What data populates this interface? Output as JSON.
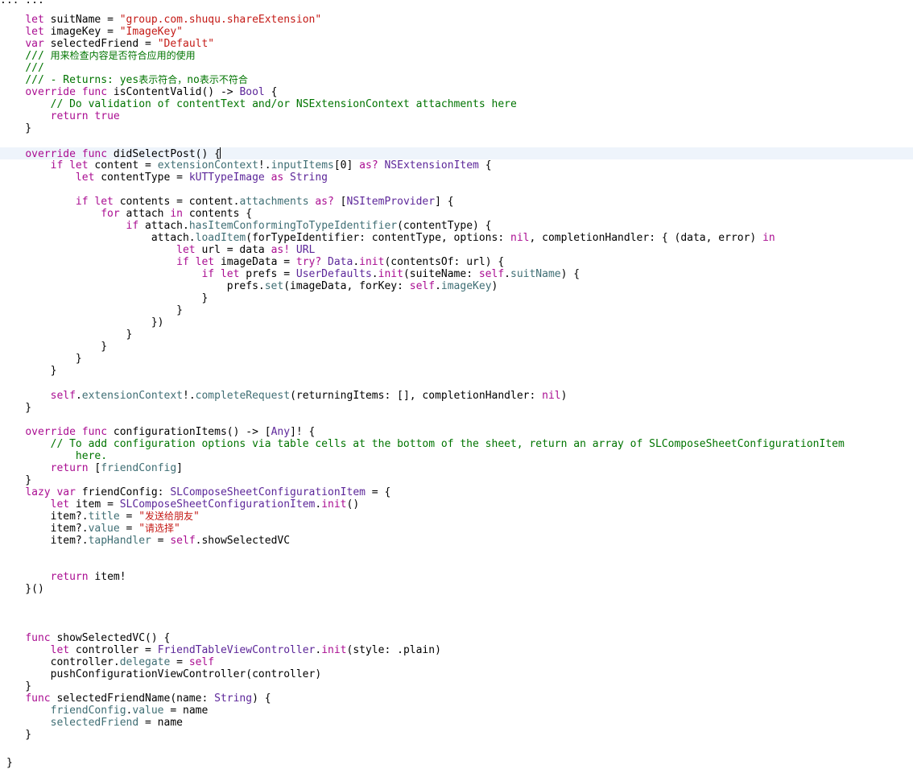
{
  "editor": {
    "language": "swift",
    "theme": {
      "keyword": "#aa0d91",
      "string": "#c41a16",
      "comment": "#007400",
      "type": "#5c2699",
      "member": "#3f6e74",
      "plain": "#000000",
      "current_line_bg": "#eef4fb"
    },
    "top_fragment": "            ...                                                                       ...",
    "cursor_line": 11,
    "trailing_brace": "}",
    "lines": [
      {
        "tokens": [
          {
            "t": "    "
          },
          {
            "t": "let",
            "c": "kw"
          },
          {
            "t": " suitName = "
          },
          {
            "t": "\"group.com.shuqu.shareExtension\"",
            "c": "str"
          }
        ]
      },
      {
        "tokens": [
          {
            "t": "    "
          },
          {
            "t": "let",
            "c": "kw"
          },
          {
            "t": " imageKey = "
          },
          {
            "t": "\"ImageKey\"",
            "c": "str"
          }
        ]
      },
      {
        "tokens": [
          {
            "t": "    "
          },
          {
            "t": "var",
            "c": "kw"
          },
          {
            "t": " selectedFriend = "
          },
          {
            "t": "\"Default\"",
            "c": "str"
          }
        ]
      },
      {
        "tokens": [
          {
            "t": "    "
          },
          {
            "t": "/// ",
            "c": "cmt"
          },
          {
            "t": "用来检查内容是否符合应用的使用",
            "c": "cmt",
            "f": "cjk"
          }
        ]
      },
      {
        "tokens": [
          {
            "t": "    "
          },
          {
            "t": "///",
            "c": "cmt"
          }
        ]
      },
      {
        "tokens": [
          {
            "t": "    "
          },
          {
            "t": "/// - Returns: yes",
            "c": "cmt"
          },
          {
            "t": "表示符合，",
            "c": "cmt",
            "f": "cjk"
          },
          {
            "t": "no",
            "c": "cmt"
          },
          {
            "t": "表示不符合",
            "c": "cmt",
            "f": "cjk"
          }
        ]
      },
      {
        "tokens": [
          {
            "t": "    "
          },
          {
            "t": "override",
            "c": "kw"
          },
          {
            "t": " "
          },
          {
            "t": "func",
            "c": "kw"
          },
          {
            "t": " isContentValid() -> "
          },
          {
            "t": "Bool",
            "c": "typ"
          },
          {
            "t": " {"
          }
        ]
      },
      {
        "tokens": [
          {
            "t": "        "
          },
          {
            "t": "// Do validation of contentText and/or NSExtensionContext attachments here",
            "c": "cmt"
          }
        ]
      },
      {
        "tokens": [
          {
            "t": "        "
          },
          {
            "t": "return",
            "c": "kw"
          },
          {
            "t": " "
          },
          {
            "t": "true",
            "c": "kw"
          }
        ]
      },
      {
        "tokens": [
          {
            "t": "    }"
          }
        ]
      },
      {
        "tokens": []
      },
      {
        "tokens": [
          {
            "t": "    "
          },
          {
            "t": "override",
            "c": "kw"
          },
          {
            "t": " "
          },
          {
            "t": "func",
            "c": "kw"
          },
          {
            "t": " didSelectPost() {"
          }
        ]
      },
      {
        "tokens": [
          {
            "t": "        "
          },
          {
            "t": "if",
            "c": "kw"
          },
          {
            "t": " "
          },
          {
            "t": "let",
            "c": "kw"
          },
          {
            "t": " content = "
          },
          {
            "t": "extensionContext",
            "c": "prop"
          },
          {
            "t": "!."
          },
          {
            "t": "inputItems",
            "c": "prop"
          },
          {
            "t": "[0] "
          },
          {
            "t": "as?",
            "c": "kw"
          },
          {
            "t": " "
          },
          {
            "t": "NSExtensionItem",
            "c": "typ"
          },
          {
            "t": " {"
          }
        ]
      },
      {
        "tokens": [
          {
            "t": "            "
          },
          {
            "t": "let",
            "c": "kw"
          },
          {
            "t": " contentType = "
          },
          {
            "t": "kUTTypeImage",
            "c": "typ"
          },
          {
            "t": " "
          },
          {
            "t": "as",
            "c": "kw"
          },
          {
            "t": " "
          },
          {
            "t": "String",
            "c": "typ"
          }
        ]
      },
      {
        "tokens": []
      },
      {
        "tokens": [
          {
            "t": "            "
          },
          {
            "t": "if",
            "c": "kw"
          },
          {
            "t": " "
          },
          {
            "t": "let",
            "c": "kw"
          },
          {
            "t": " contents = content."
          },
          {
            "t": "attachments",
            "c": "prop"
          },
          {
            "t": " "
          },
          {
            "t": "as?",
            "c": "kw"
          },
          {
            "t": " ["
          },
          {
            "t": "NSItemProvider",
            "c": "typ"
          },
          {
            "t": "] {"
          }
        ]
      },
      {
        "tokens": [
          {
            "t": "                "
          },
          {
            "t": "for",
            "c": "kw"
          },
          {
            "t": " attach "
          },
          {
            "t": "in",
            "c": "kw"
          },
          {
            "t": " contents {"
          }
        ]
      },
      {
        "tokens": [
          {
            "t": "                    "
          },
          {
            "t": "if",
            "c": "kw"
          },
          {
            "t": " attach."
          },
          {
            "t": "hasItemConformingToTypeIdentifier",
            "c": "prop"
          },
          {
            "t": "(contentType) {"
          }
        ]
      },
      {
        "tokens": [
          {
            "t": "                        attach."
          },
          {
            "t": "loadItem",
            "c": "prop"
          },
          {
            "t": "(forTypeIdentifier: contentType, options: "
          },
          {
            "t": "nil",
            "c": "kw"
          },
          {
            "t": ", completionHandler: { (data, error) "
          },
          {
            "t": "in",
            "c": "kw"
          }
        ]
      },
      {
        "tokens": [
          {
            "t": "                            "
          },
          {
            "t": "let",
            "c": "kw"
          },
          {
            "t": " url = data "
          },
          {
            "t": "as!",
            "c": "kw"
          },
          {
            "t": " "
          },
          {
            "t": "URL",
            "c": "typ"
          }
        ]
      },
      {
        "tokens": [
          {
            "t": "                            "
          },
          {
            "t": "if",
            "c": "kw"
          },
          {
            "t": " "
          },
          {
            "t": "let",
            "c": "kw"
          },
          {
            "t": " imageData = "
          },
          {
            "t": "try?",
            "c": "kw"
          },
          {
            "t": " "
          },
          {
            "t": "Data",
            "c": "typ"
          },
          {
            "t": "."
          },
          {
            "t": "init",
            "c": "kw"
          },
          {
            "t": "(contentsOf: url) {"
          }
        ]
      },
      {
        "tokens": [
          {
            "t": "                                "
          },
          {
            "t": "if",
            "c": "kw"
          },
          {
            "t": " "
          },
          {
            "t": "let",
            "c": "kw"
          },
          {
            "t": " prefs = "
          },
          {
            "t": "UserDefaults",
            "c": "typ"
          },
          {
            "t": "."
          },
          {
            "t": "init",
            "c": "kw"
          },
          {
            "t": "(suiteName: "
          },
          {
            "t": "self",
            "c": "kw"
          },
          {
            "t": "."
          },
          {
            "t": "suitName",
            "c": "prop"
          },
          {
            "t": ") {"
          }
        ]
      },
      {
        "tokens": [
          {
            "t": "                                    prefs."
          },
          {
            "t": "set",
            "c": "prop"
          },
          {
            "t": "(imageData, forKey: "
          },
          {
            "t": "self",
            "c": "kw"
          },
          {
            "t": "."
          },
          {
            "t": "imageKey",
            "c": "prop"
          },
          {
            "t": ")"
          }
        ]
      },
      {
        "tokens": [
          {
            "t": "                                }"
          }
        ]
      },
      {
        "tokens": [
          {
            "t": "                            }"
          }
        ]
      },
      {
        "tokens": [
          {
            "t": "                        })"
          }
        ]
      },
      {
        "tokens": [
          {
            "t": "                    }"
          }
        ]
      },
      {
        "tokens": [
          {
            "t": "                }"
          }
        ]
      },
      {
        "tokens": [
          {
            "t": "            }"
          }
        ]
      },
      {
        "tokens": [
          {
            "t": "        }"
          }
        ]
      },
      {
        "tokens": []
      },
      {
        "tokens": [
          {
            "t": "        "
          },
          {
            "t": "self",
            "c": "kw"
          },
          {
            "t": "."
          },
          {
            "t": "extensionContext",
            "c": "prop"
          },
          {
            "t": "!."
          },
          {
            "t": "completeRequest",
            "c": "prop"
          },
          {
            "t": "(returningItems: [], completionHandler: "
          },
          {
            "t": "nil",
            "c": "kw"
          },
          {
            "t": ")"
          }
        ]
      },
      {
        "tokens": [
          {
            "t": "    }"
          }
        ]
      },
      {
        "tokens": []
      },
      {
        "tokens": [
          {
            "t": "    "
          },
          {
            "t": "override",
            "c": "kw"
          },
          {
            "t": " "
          },
          {
            "t": "func",
            "c": "kw"
          },
          {
            "t": " configurationItems() -> ["
          },
          {
            "t": "Any",
            "c": "typ"
          },
          {
            "t": "]! {"
          }
        ]
      },
      {
        "tokens": [
          {
            "t": "        "
          },
          {
            "t": "// To add configuration options via table cells at the bottom of the sheet, return an array of SLComposeSheetConfigurationItem",
            "c": "cmt"
          }
        ]
      },
      {
        "tokens": [
          {
            "t": "            "
          },
          {
            "t": "here.",
            "c": "cmt"
          }
        ]
      },
      {
        "tokens": [
          {
            "t": "        "
          },
          {
            "t": "return",
            "c": "kw"
          },
          {
            "t": " ["
          },
          {
            "t": "friendConfig",
            "c": "prop"
          },
          {
            "t": "]"
          }
        ]
      },
      {
        "tokens": [
          {
            "t": "    }"
          }
        ]
      },
      {
        "tokens": [
          {
            "t": "    "
          },
          {
            "t": "lazy",
            "c": "kw"
          },
          {
            "t": " "
          },
          {
            "t": "var",
            "c": "kw"
          },
          {
            "t": " friendConfig: "
          },
          {
            "t": "SLComposeSheetConfigurationItem",
            "c": "typ"
          },
          {
            "t": " = {"
          }
        ]
      },
      {
        "tokens": [
          {
            "t": "        "
          },
          {
            "t": "let",
            "c": "kw"
          },
          {
            "t": " item = "
          },
          {
            "t": "SLComposeSheetConfigurationItem",
            "c": "typ"
          },
          {
            "t": "."
          },
          {
            "t": "init",
            "c": "kw"
          },
          {
            "t": "()"
          }
        ]
      },
      {
        "tokens": [
          {
            "t": "        item?."
          },
          {
            "t": "title",
            "c": "prop"
          },
          {
            "t": " = "
          },
          {
            "t": "\"",
            "c": "str"
          },
          {
            "t": "发送给朋友",
            "c": "str",
            "f": "cjk"
          },
          {
            "t": "\"",
            "c": "str"
          }
        ]
      },
      {
        "tokens": [
          {
            "t": "        item?."
          },
          {
            "t": "value",
            "c": "prop"
          },
          {
            "t": " = "
          },
          {
            "t": "\"",
            "c": "str"
          },
          {
            "t": "请选择",
            "c": "str",
            "f": "cjk"
          },
          {
            "t": "\"",
            "c": "str"
          }
        ]
      },
      {
        "tokens": [
          {
            "t": "        item?."
          },
          {
            "t": "tapHandler",
            "c": "prop"
          },
          {
            "t": " = "
          },
          {
            "t": "self",
            "c": "kw"
          },
          {
            "t": ".showSelectedVC"
          }
        ]
      },
      {
        "tokens": []
      },
      {
        "tokens": []
      },
      {
        "tokens": [
          {
            "t": "        "
          },
          {
            "t": "return",
            "c": "kw"
          },
          {
            "t": " item!"
          }
        ]
      },
      {
        "tokens": [
          {
            "t": "    }()"
          }
        ]
      },
      {
        "tokens": []
      },
      {
        "tokens": []
      },
      {
        "tokens": []
      },
      {
        "tokens": [
          {
            "t": "    "
          },
          {
            "t": "func",
            "c": "kw"
          },
          {
            "t": " showSelectedVC() {"
          }
        ]
      },
      {
        "tokens": [
          {
            "t": "        "
          },
          {
            "t": "let",
            "c": "kw"
          },
          {
            "t": " controller = "
          },
          {
            "t": "FriendTableViewController",
            "c": "typ"
          },
          {
            "t": "."
          },
          {
            "t": "init",
            "c": "kw"
          },
          {
            "t": "(style: .plain)"
          }
        ]
      },
      {
        "tokens": [
          {
            "t": "        controller."
          },
          {
            "t": "delegate",
            "c": "prop"
          },
          {
            "t": " = "
          },
          {
            "t": "self",
            "c": "kw"
          }
        ]
      },
      {
        "tokens": [
          {
            "t": "        pushConfigurationViewController(controller)"
          }
        ]
      },
      {
        "tokens": [
          {
            "t": "    }"
          }
        ]
      },
      {
        "tokens": [
          {
            "t": "    "
          },
          {
            "t": "func",
            "c": "kw"
          },
          {
            "t": " selectedFriendName(name: "
          },
          {
            "t": "String",
            "c": "typ"
          },
          {
            "t": ") {"
          }
        ]
      },
      {
        "tokens": [
          {
            "t": "        "
          },
          {
            "t": "friendConfig",
            "c": "prop"
          },
          {
            "t": "."
          },
          {
            "t": "value",
            "c": "prop"
          },
          {
            "t": " = name"
          }
        ]
      },
      {
        "tokens": [
          {
            "t": "        "
          },
          {
            "t": "selectedFriend",
            "c": "prop"
          },
          {
            "t": " = name"
          }
        ]
      },
      {
        "tokens": [
          {
            "t": "    }"
          }
        ]
      }
    ]
  }
}
